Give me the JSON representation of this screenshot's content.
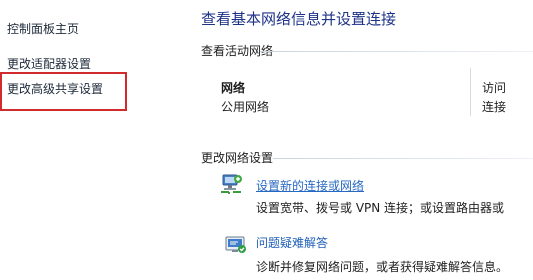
{
  "sidebar": {
    "home": "控制面板主页",
    "adapter": "更改适配器设置",
    "sharing": "更改高级共享设置"
  },
  "main": {
    "title": "查看基本网络信息并设置连接",
    "active_section": "查看活动网络",
    "network_name": "网络",
    "network_type": "公用网络",
    "access_type_label": "访问",
    "connections_label": "连接",
    "change_section": "更改网络设置",
    "tasks": [
      {
        "label": "设置新的连接或网络",
        "description": "设置宽带、拨号或 VPN 连接；或设置路由器或",
        "icon": "new-connection-icon"
      },
      {
        "label": "问题疑难解答",
        "description": "诊断并修复网络问题，或者获得疑难解答信息。",
        "icon": "troubleshoot-icon"
      }
    ]
  },
  "colors": {
    "title": "#1e3287",
    "link": "#2668c2",
    "highlight": "#d12b2b"
  }
}
